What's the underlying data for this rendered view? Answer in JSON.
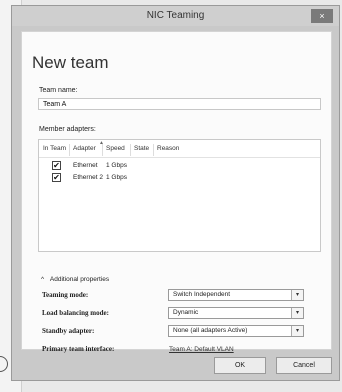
{
  "window": {
    "title": "NIC Teaming",
    "close": "×"
  },
  "dialog": {
    "heading": "New team",
    "team_name_label": "Team name:",
    "team_name_value": "Team A",
    "member_adapters_label": "Member adapters:",
    "columns": [
      "In Team",
      "Adapter",
      "Speed",
      "State",
      "Reason"
    ],
    "adapters": [
      {
        "checked": true,
        "check_glyph": "✔",
        "adapter": "Ethernet",
        "speed": "1 Gbps"
      },
      {
        "checked": true,
        "check_glyph": "✔",
        "adapter": "Ethernet 2",
        "speed": "1 Gbps"
      }
    ],
    "additional_properties": {
      "toggle_glyph": "^",
      "label": "Additional properties",
      "teaming_mode": {
        "label": "Teaming mode:",
        "value": "Switch Independent"
      },
      "load_balancing_mode": {
        "label": "Load balancing mode:",
        "value": "Dynamic"
      },
      "standby_adapter": {
        "label": "Standby adapter:",
        "value": "None (all adapters Active)"
      },
      "primary_team_interface": {
        "label": "Primary team interface:",
        "value": "Team A: Default VLAN"
      }
    },
    "dropdown_arrow": "▾",
    "ok_label": "OK",
    "cancel_label": "Cancel"
  }
}
